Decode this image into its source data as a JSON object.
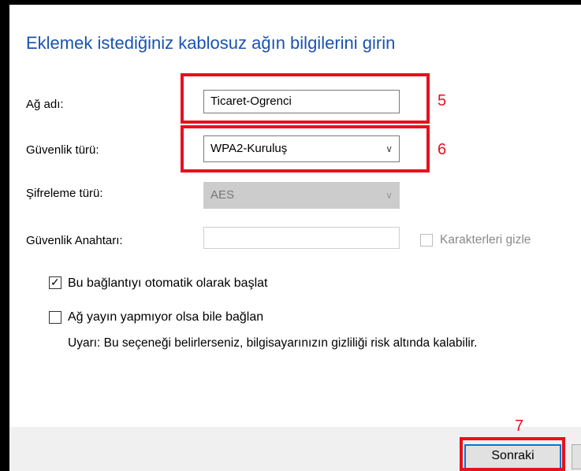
{
  "dialog": {
    "title": "Eklemek istediğiniz kablosuz ağın bilgilerini girin"
  },
  "network_name": {
    "label": "Ağ adı:",
    "value": "Ticaret-Ogrenci",
    "marker": "5"
  },
  "security_type": {
    "label": "Güvenlik türü:",
    "value": "WPA2-Kuruluş",
    "marker": "6"
  },
  "encryption_type": {
    "label": "Şifreleme türü:",
    "value": "AES"
  },
  "security_key": {
    "label": "Güvenlik Anahtarı:",
    "value": "",
    "hide_chars_label": "Karakterleri gizle",
    "hide_chars_checked": false
  },
  "options": {
    "auto_connect_label": "Bu bağlantıyı otomatik olarak başlat",
    "auto_connect_checked": true,
    "hidden_network_label": "Ağ yayın yapmıyor olsa bile bağlan",
    "hidden_network_checked": false,
    "warning": "Uyarı: Bu seçeneği belirlerseniz, bilgisayarınızın gizliliği risk altında kalabilir."
  },
  "footer": {
    "next_label": "Sonraki",
    "marker": "7"
  },
  "icons": {
    "chevron": "chevron-down-icon",
    "check": "checkmark-icon"
  },
  "colors": {
    "heading": "#1a53b0",
    "annotation": "#e8101c",
    "button_focus": "#0078d7"
  }
}
